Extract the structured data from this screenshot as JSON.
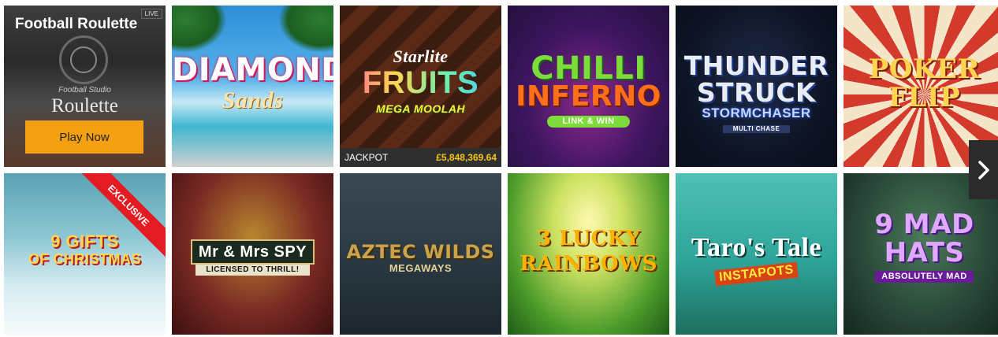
{
  "tiles_row1": {
    "t1": {
      "title": "Football Roulette",
      "live": "LIVE",
      "logo_top": "Football Studio",
      "logo_main": "Roulette",
      "play": "Play Now"
    },
    "t2": {
      "line1": "DIAMOND",
      "line2": "Sands"
    },
    "t3": {
      "line1": "Starlite",
      "line2": "FRUITS",
      "line3": "MEGA MOOLAH",
      "jackpot_label": "JACKPOT",
      "jackpot_value": "£5,848,369.64"
    },
    "t4": {
      "line1": "CHILLI",
      "line2": "INFERNO",
      "line3": "LINK & WIN"
    },
    "t5": {
      "line1": "THUNDER",
      "line2": "STRUCK",
      "line3": "STORMCHASER",
      "line4": "MULTI CHASE"
    },
    "t6": {
      "line1": "POKER",
      "line2": "FLIP"
    }
  },
  "tiles_row2": {
    "t7": {
      "badge": "EXCLUSIVE",
      "line1": "9 GIFTS",
      "line2": "OF CHRISTMAS"
    },
    "t8": {
      "line1": "Mr & Mrs SPY",
      "line2": "LICENSED TO THRILL!"
    },
    "t9": {
      "line1": "AZTEC WILDS",
      "line2": "MEGAWAYS"
    },
    "t10": {
      "line1": "3 LUCKY",
      "line2": "RAINBOWS"
    },
    "t11": {
      "line1": "Taro's Tale",
      "line2": "INSTAPOTS"
    },
    "t12": {
      "line1": "9 MAD",
      "line2": "HATS",
      "line3": "ABSOLUTELY MAD"
    }
  },
  "colors": {
    "play_button": "#f5a013",
    "jackpot_value": "#f5c518",
    "exclusive_ribbon": "#e31b23",
    "arrow_bg": "#2b2b2b"
  },
  "icons": {
    "next": "chevron-right-icon"
  }
}
